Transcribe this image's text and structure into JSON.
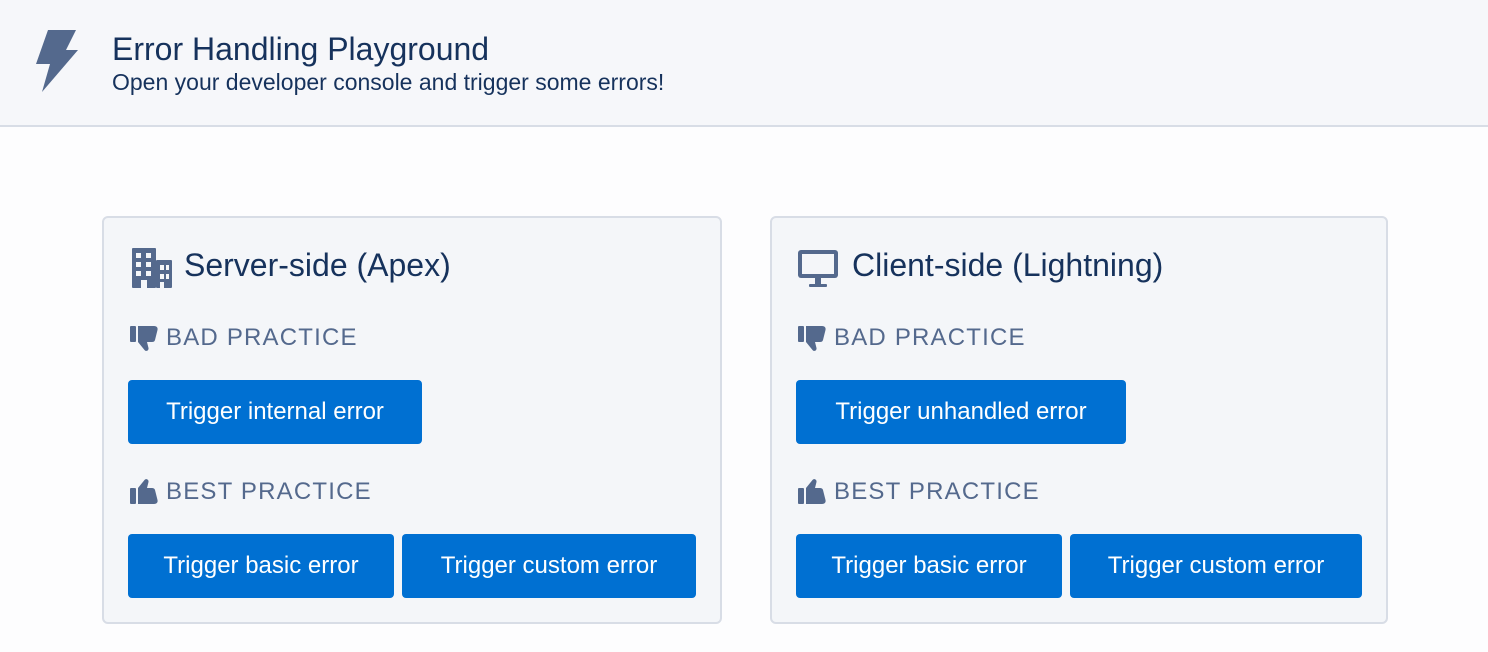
{
  "header": {
    "icon": "lightning-bolt-icon",
    "title": "Error Handling Playground",
    "subtitle": "Open your developer console and trigger some errors!"
  },
  "cards": [
    {
      "icon": "building-icon",
      "title": "Server-side (Apex)",
      "bad_practice": {
        "icon": "thumbs-down-icon",
        "label": "BAD PRACTICE",
        "buttons": [
          "Trigger internal error"
        ]
      },
      "best_practice": {
        "icon": "thumbs-up-icon",
        "label": "BEST PRACTICE",
        "buttons": [
          "Trigger basic error",
          "Trigger custom error"
        ]
      }
    },
    {
      "icon": "desktop-icon",
      "title": "Client-side (Lightning)",
      "bad_practice": {
        "icon": "thumbs-down-icon",
        "label": "BAD PRACTICE",
        "buttons": [
          "Trigger unhandled error"
        ]
      },
      "best_practice": {
        "icon": "thumbs-up-icon",
        "label": "BEST PRACTICE",
        "buttons": [
          "Trigger basic error",
          "Trigger custom error"
        ]
      }
    }
  ],
  "colors": {
    "brand_button": "#0070d2",
    "header_background": "#f6f7fa",
    "card_background": "#f4f6f9",
    "border": "#d8dde6",
    "text_primary": "#16325c",
    "text_secondary": "#54698d",
    "icon": "#54698d"
  }
}
